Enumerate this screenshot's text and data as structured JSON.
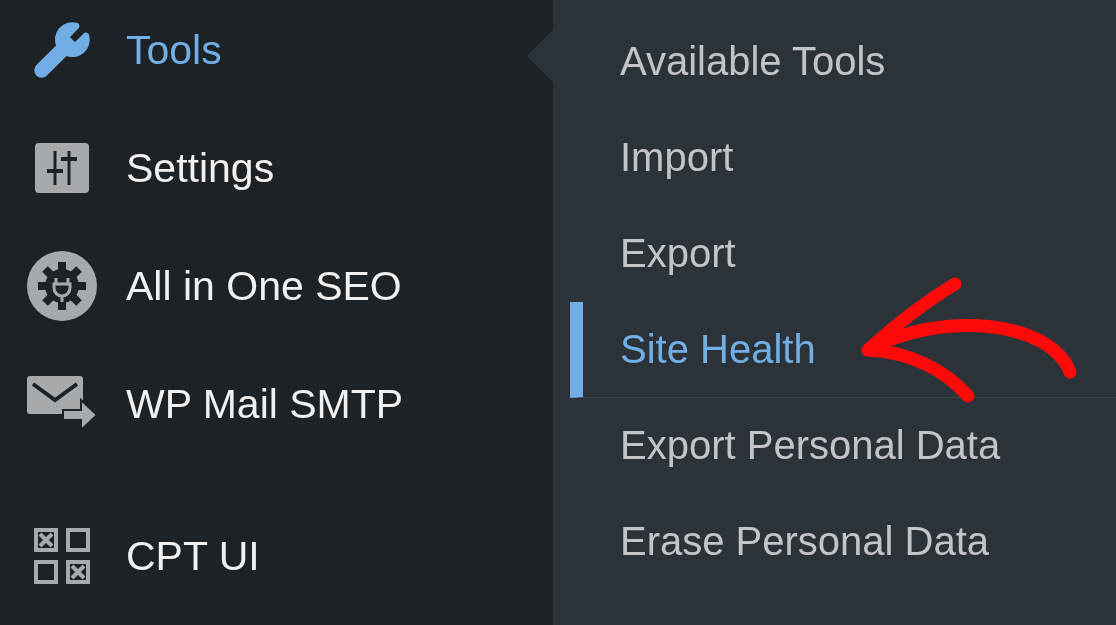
{
  "menu": {
    "items": [
      {
        "label": "Tools",
        "selected": true
      },
      {
        "label": "Settings",
        "selected": false
      },
      {
        "label": "All in One SEO",
        "selected": false
      },
      {
        "label": "WP Mail SMTP",
        "selected": false
      },
      {
        "label": "CPT UI",
        "selected": false
      }
    ]
  },
  "submenu": {
    "items": [
      {
        "label": "Available Tools",
        "selected": false
      },
      {
        "label": "Import",
        "selected": false
      },
      {
        "label": "Export",
        "selected": false
      },
      {
        "label": "Site Health",
        "selected": true
      },
      {
        "label": "Export Personal Data",
        "selected": false
      },
      {
        "label": "Erase Personal Data",
        "selected": false
      }
    ]
  }
}
